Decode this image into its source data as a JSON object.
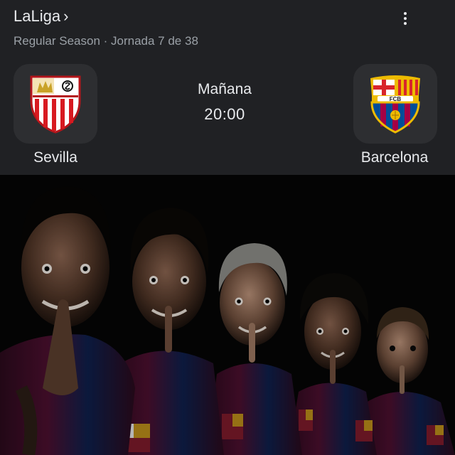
{
  "league": {
    "title": "LaLiga",
    "chevron": "›",
    "subtitle": "Regular Season · Jornada 7 de 38"
  },
  "menu": {
    "icon": "more-vert-icon"
  },
  "match": {
    "day": "Mañana",
    "time": "20:00"
  },
  "home_team": {
    "name": "Sevilla",
    "crest": "sevilla-crest",
    "colors": [
      "#d81920",
      "#ffffff",
      "#c9a227"
    ]
  },
  "away_team": {
    "name": "Barcelona",
    "crest": "barcelona-crest",
    "colors": [
      "#a50044",
      "#004d98",
      "#edbb00"
    ]
  },
  "hero_image": {
    "content": "promotional photo of five Barcelona players making a shushing gesture against a dark background"
  },
  "colors": {
    "background": "#202124",
    "logo_tile": "#2d2e31",
    "text": "#e8eaed",
    "muted": "#9aa0a6"
  }
}
